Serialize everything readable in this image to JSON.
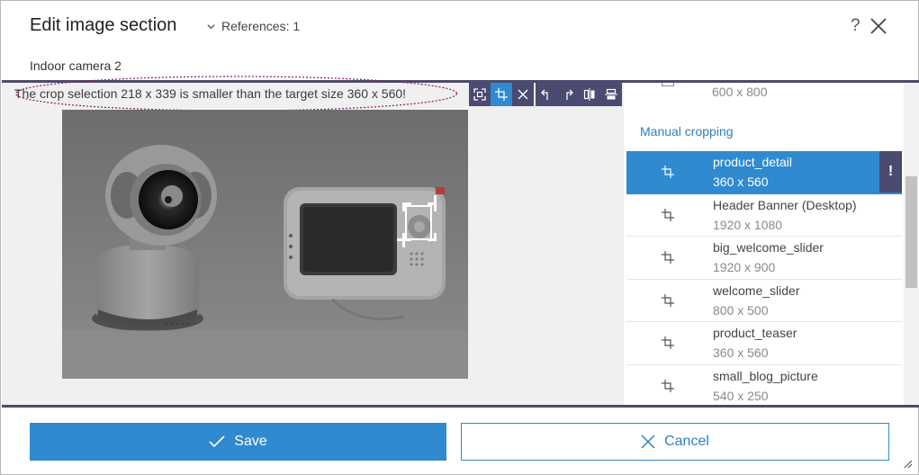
{
  "dialog": {
    "title": "Edit image section",
    "references_label": "References: 1",
    "help_label": "?",
    "subtitle": "Indoor camera 2"
  },
  "editor": {
    "warning": "The crop selection 218 x 339 is smaller than the target size 360 x 560!",
    "toolbar": [
      "fit-selection-icon",
      "crop-icon",
      "clear-icon",
      "rotate-left-icon",
      "rotate-right-icon",
      "flip-horizontal-icon",
      "flip-vertical-icon"
    ]
  },
  "panel": {
    "top_entry_size": "600 x 800",
    "section_title": "Manual cropping",
    "selected_flag": "!",
    "items": [
      {
        "name": "product_detail",
        "dims": "360 x 560"
      },
      {
        "name": "Header Banner (Desktop)",
        "dims": "1920 x 1080"
      },
      {
        "name": "big_welcome_slider",
        "dims": "1920 x 900"
      },
      {
        "name": "welcome_slider",
        "dims": "800 x 500"
      },
      {
        "name": "product_teaser",
        "dims": "360 x 560"
      },
      {
        "name": "small_blog_picture",
        "dims": "540 x 250"
      }
    ]
  },
  "footer": {
    "save_label": "Save",
    "cancel_label": "Cancel"
  },
  "colors": {
    "accent": "#2f8ad0",
    "dark": "#4b4a70",
    "link": "#2f7fc1",
    "annotation": "#8b1a6b"
  }
}
